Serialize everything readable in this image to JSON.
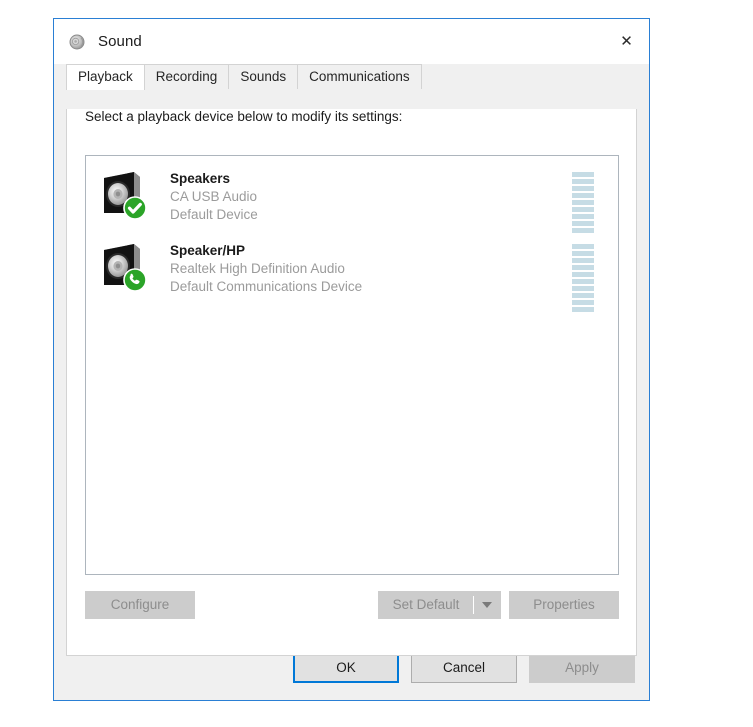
{
  "window": {
    "title": "Sound",
    "title_icon": "speaker-icon",
    "close_label": "✕",
    "border_color": "#2a7fd4"
  },
  "tabs": [
    {
      "label": "Playback",
      "active": true
    },
    {
      "label": "Recording",
      "active": false
    },
    {
      "label": "Sounds",
      "active": false
    },
    {
      "label": "Communications",
      "active": false
    }
  ],
  "playback": {
    "hint": "Select a playback device below to modify its settings:",
    "devices": [
      {
        "name": "Speakers",
        "driver": "CA USB Audio",
        "status": "Default Device",
        "badge": "check-badge-icon",
        "badge_color": "#2ba428",
        "meter_segments": 9,
        "meter_active": 0
      },
      {
        "name": "Speaker/HP",
        "driver": "Realtek High Definition Audio",
        "status": "Default Communications Device",
        "badge": "phone-badge-icon",
        "badge_color": "#2ba428",
        "meter_segments": 10,
        "meter_active": 0
      }
    ],
    "meter_color": "#c6dce5",
    "buttons": {
      "configure": "Configure",
      "set_default": "Set Default",
      "set_default_arrow": "chevron-down-icon",
      "properties": "Properties"
    }
  },
  "footer": {
    "ok": "OK",
    "cancel": "Cancel",
    "apply": "Apply",
    "accent": "#0078d7"
  }
}
